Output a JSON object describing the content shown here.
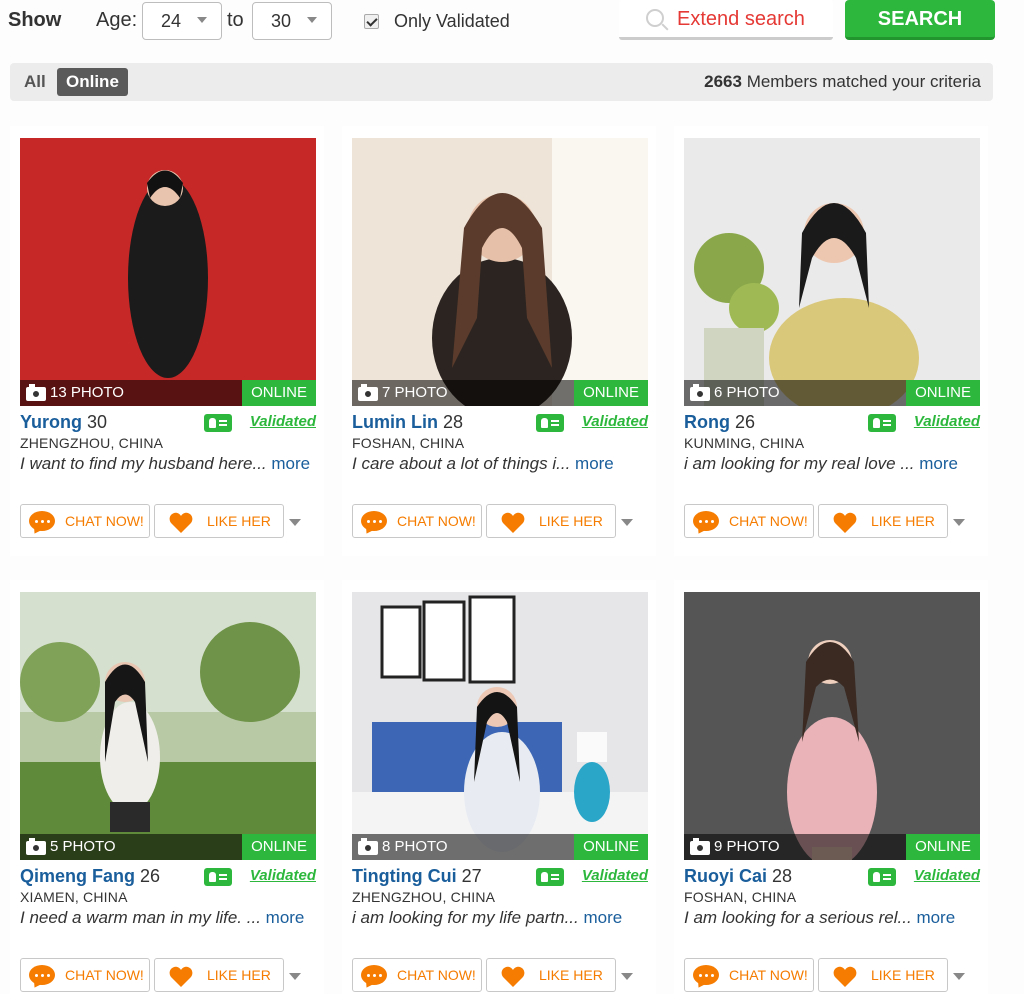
{
  "filters": {
    "show_label": "Show",
    "age_label": "Age:",
    "age_from": "24",
    "to_label": "to",
    "age_to": "30",
    "only_validated_label": "Only Validated",
    "only_validated_checked": true,
    "extend_search_label": "Extend search",
    "search_button_label": "SEARCH"
  },
  "status_bar": {
    "all_label": "All",
    "online_label": "Online",
    "match_count": "2663",
    "match_text": " Members matched your criteria"
  },
  "colors": {
    "accent_green": "#2db83d",
    "link_blue": "#1a5e9c",
    "action_orange": "#f57c00",
    "extend_red": "#e53935"
  },
  "profiles": [
    {
      "name": "Yurong",
      "age": "30",
      "location": "ZHENGZHOU, CHINA",
      "photo_count": "13 PHOTO",
      "online_label": "ONLINE",
      "validated_label": "Validated",
      "about": "I want to find my husband here... ",
      "more_label": "more",
      "chat_label": "CHAT NOW!",
      "like_label": "LIKE HER"
    },
    {
      "name": "Lumin Lin",
      "age": "28",
      "location": "FOSHAN, CHINA",
      "photo_count": "7 PHOTO",
      "online_label": "ONLINE",
      "validated_label": "Validated",
      "about": "I care about a lot of things i... ",
      "more_label": "more",
      "chat_label": "CHAT NOW!",
      "like_label": "LIKE HER"
    },
    {
      "name": "Rong",
      "age": "26",
      "location": "KUNMING, CHINA",
      "photo_count": "6 PHOTO",
      "online_label": "ONLINE",
      "validated_label": "Validated",
      "about": "i am looking for my real love ... ",
      "more_label": "more",
      "chat_label": "CHAT NOW!",
      "like_label": "LIKE HER"
    },
    {
      "name": "Qimeng Fang",
      "age": "26",
      "location": "XIAMEN, CHINA",
      "photo_count": "5 PHOTO",
      "online_label": "ONLINE",
      "validated_label": "Validated",
      "about": "I need a warm man in my life. ... ",
      "more_label": "more",
      "chat_label": "CHAT NOW!",
      "like_label": "LIKE HER"
    },
    {
      "name": "Tingting Cui",
      "age": "27",
      "location": "ZHENGZHOU, CHINA",
      "photo_count": "8 PHOTO",
      "online_label": "ONLINE",
      "validated_label": "Validated",
      "about": "i am looking for my life partn... ",
      "more_label": "more",
      "chat_label": "CHAT NOW!",
      "like_label": "LIKE HER"
    },
    {
      "name": "Ruoyi Cai",
      "age": "28",
      "location": "FOSHAN, CHINA",
      "photo_count": "9 PHOTO",
      "online_label": "ONLINE",
      "validated_label": "Validated",
      "about": "I am looking for a serious rel... ",
      "more_label": "more",
      "chat_label": "CHAT NOW!",
      "like_label": "LIKE HER"
    }
  ]
}
